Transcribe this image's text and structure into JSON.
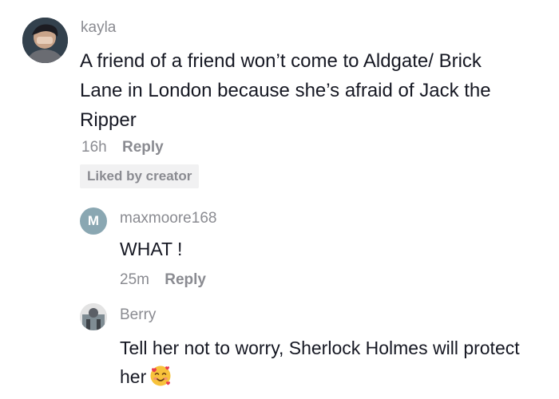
{
  "comments": [
    {
      "username": "kayla",
      "text": "A friend of a friend won’t come to Aldgate/ Brick Lane in London because she’s afraid of Jack the Ripper",
      "time": "16h",
      "reply_label": "Reply",
      "liked_badge": "Liked by creator",
      "avatar_icon": "user-photo-avatar"
    }
  ],
  "replies": [
    {
      "username": "maxmoore168",
      "avatar_letter": "M",
      "avatar_color": "#8aa7b2",
      "text": "WHAT !",
      "time": "25m",
      "reply_label": "Reply"
    },
    {
      "username": "Berry",
      "avatar_icon": "user-photo-avatar",
      "text": "Tell her not to worry, Sherlock Holmes will protect her",
      "emoji": "smiling-face-with-hearts"
    }
  ]
}
